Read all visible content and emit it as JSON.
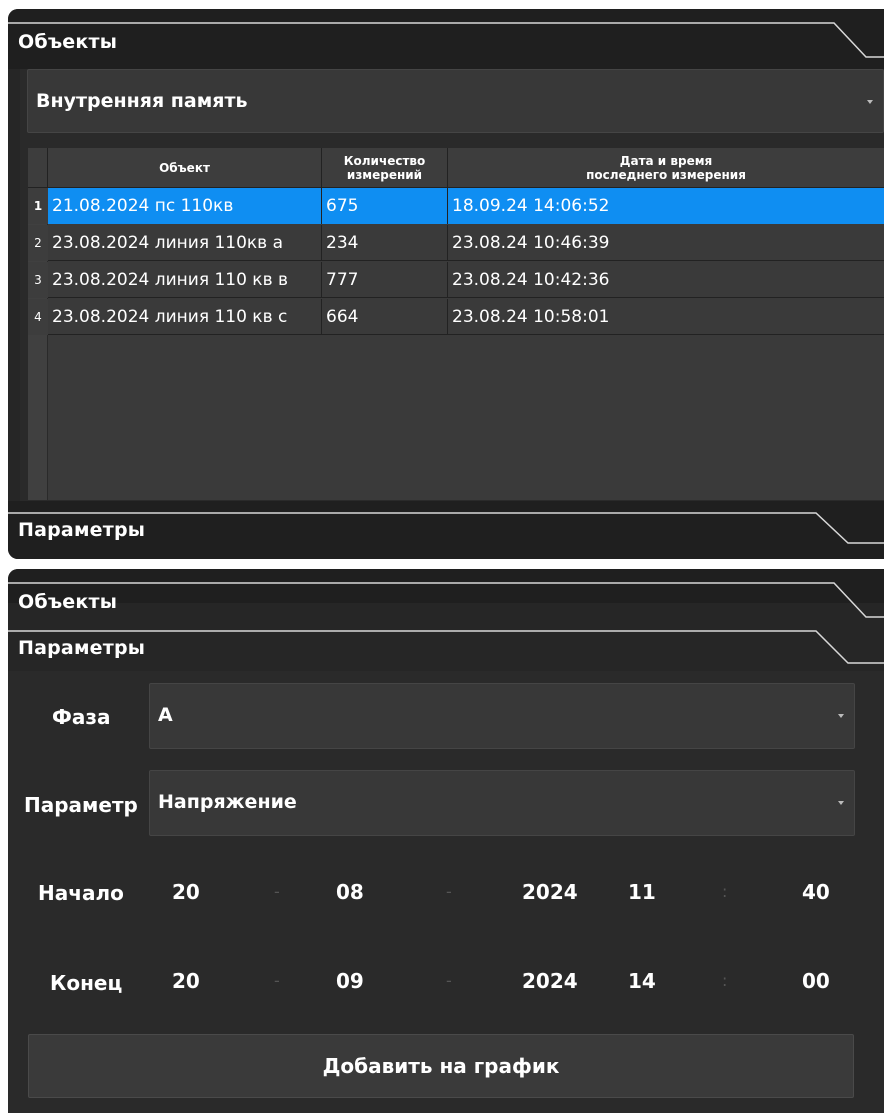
{
  "top_panel": {
    "objects_title": "Объекты",
    "params_title": "Параметры",
    "storage_dropdown": "Внутренняя память",
    "table": {
      "headers": {
        "object": "Объект",
        "count_line1": "Количество",
        "count_line2": "измерений",
        "date_line1": "Дата и время",
        "date_line2": "последнего измерения"
      },
      "rows": [
        {
          "idx": "1",
          "object": "21.08.2024  пс 110кв",
          "count": "675",
          "date": "18.09.24 14:06:52"
        },
        {
          "idx": "2",
          "object": "23.08.2024 линия 110кв а",
          "count": "234",
          "date": "23.08.24 10:46:39"
        },
        {
          "idx": "3",
          "object": "23.08.2024 линия 110 кв в",
          "count": "777",
          "date": "23.08.24 10:42:36"
        },
        {
          "idx": "4",
          "object": "23.08.2024 линия 110 кв с",
          "count": "664",
          "date": "23.08.24 10:58:01"
        }
      ],
      "selected_row": 1
    }
  },
  "bottom_panel": {
    "objects_title": "Объекты",
    "params_title": "Параметры",
    "phase_label": "Фаза",
    "phase_value": "А",
    "param_label": "Параметр",
    "param_value": "Напряжение",
    "start": {
      "label": "Начало",
      "day": "20",
      "month": "08",
      "year": "2024",
      "hour": "11",
      "minute": "40"
    },
    "end": {
      "label": "Конец",
      "day": "20",
      "month": "09",
      "year": "2024",
      "hour": "14",
      "minute": "00"
    },
    "date_sep": "-",
    "time_sep": ":",
    "add_button": "Добавить на график"
  },
  "colors": {
    "background": "#262626",
    "header": "#1f1f1f",
    "selection": "#0f8ef2",
    "row": "#3a3a3a"
  },
  "icons": [
    "dropdown-arrow-icon"
  ]
}
